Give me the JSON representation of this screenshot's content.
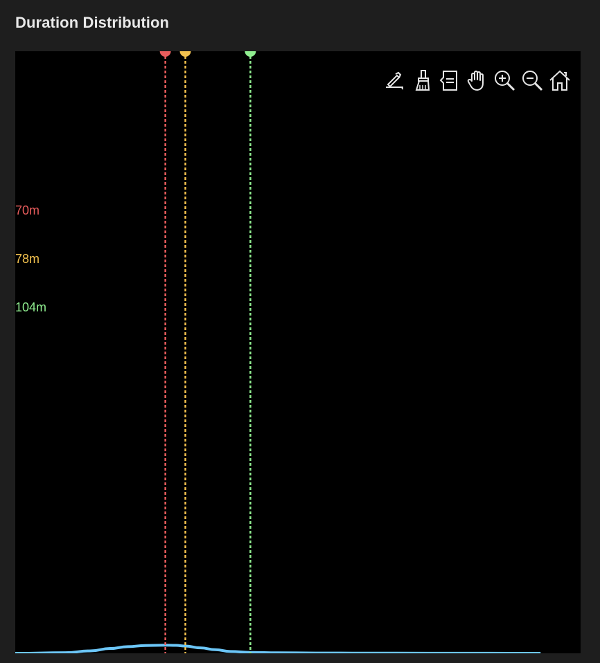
{
  "panel": {
    "title": "Duration Distribution"
  },
  "toolbar": {
    "tools": [
      {
        "icon": "annotate-icon"
      },
      {
        "icon": "brush-icon"
      },
      {
        "icon": "filter-icon"
      },
      {
        "icon": "pan-hand-icon"
      },
      {
        "icon": "zoom-in-icon"
      },
      {
        "icon": "zoom-out-icon"
      },
      {
        "icon": "home-icon"
      }
    ]
  },
  "chart_data": {
    "type": "area",
    "background": "#000000",
    "curve_color": "#6cc6f7",
    "x_view": [
      10,
      236
    ],
    "y_view": [
      0,
      1
    ],
    "density": {
      "x": [
        10,
        30,
        40,
        48,
        55,
        62,
        70,
        74,
        78,
        84,
        90,
        96,
        104,
        115,
        130,
        150,
        175,
        200,
        220
      ],
      "y": [
        0,
        0.001,
        0.004,
        0.008,
        0.011,
        0.013,
        0.0135,
        0.0132,
        0.012,
        0.009,
        0.006,
        0.003,
        0.0015,
        0.0009,
        0.0005,
        0.0003,
        0.0002,
        0.0001,
        0
      ]
    },
    "markers": [
      {
        "value": 70,
        "label": "70m",
        "color": "#e85c5c"
      },
      {
        "value": 78,
        "label": "78m",
        "color": "#f2c14e"
      },
      {
        "value": 104,
        "label": "104m",
        "color": "#90ee90"
      }
    ]
  }
}
